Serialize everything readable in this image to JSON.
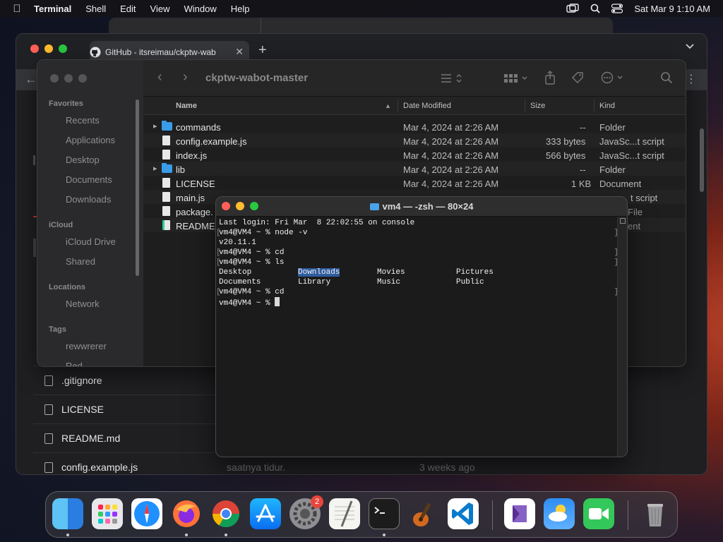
{
  "menubar": {
    "app_name": "Terminal",
    "items": [
      "Shell",
      "Edit",
      "View",
      "Window",
      "Help"
    ],
    "clock": "Sat Mar 9  1:10 AM"
  },
  "browser": {
    "tab_title": "GitHub - itsreimau/ckptw-wab",
    "tab_close": "✕",
    "new_tab": "+",
    "files": [
      ".gitignore",
      "LICENSE",
      "README.md",
      "config.example.js"
    ],
    "commit_message": "saatnya tidur.",
    "commit_time": "3 weeks ago"
  },
  "finder": {
    "title": "ckptw-wabot-master",
    "sidebar": {
      "favorites_label": "Favorites",
      "favorites": [
        "Recents",
        "Applications",
        "Desktop",
        "Documents",
        "Downloads"
      ],
      "icloud_label": "iCloud",
      "icloud": [
        "iCloud Drive",
        "Shared"
      ],
      "locations_label": "Locations",
      "locations": [
        "Network"
      ],
      "tags_label": "Tags",
      "tags": [
        "rewwrerer",
        "Red"
      ]
    },
    "columns": {
      "name": "Name",
      "date": "Date Modified",
      "size": "Size",
      "kind": "Kind"
    },
    "rows": [
      {
        "name": "commands",
        "date": "Mar 4, 2024 at 2:26 AM",
        "size": "--",
        "kind": "Folder"
      },
      {
        "name": "config.example.js",
        "date": "Mar 4, 2024 at 2:26 AM",
        "size": "333 bytes",
        "kind": "JavaSc...t script"
      },
      {
        "name": "index.js",
        "date": "Mar 4, 2024 at 2:26 AM",
        "size": "566 bytes",
        "kind": "JavaSc...t script"
      },
      {
        "name": "lib",
        "date": "Mar 4, 2024 at 2:26 AM",
        "size": "--",
        "kind": "Folder"
      },
      {
        "name": "LICENSE",
        "date": "Mar 4, 2024 at 2:26 AM",
        "size": "1 KB",
        "kind": "Document"
      },
      {
        "name": "main.js",
        "date": "",
        "size": "",
        "kind": "t script"
      },
      {
        "name": "package.",
        "date": "",
        "size": "",
        "kind": "File"
      },
      {
        "name": "README.",
        "date": "",
        "size": "",
        "kind": "ent"
      }
    ]
  },
  "terminal": {
    "title": "vm4 — -zsh — 80×24",
    "lines": {
      "login": "Last login: Fri Mar  8 22:02:55 on console",
      "cmd1": "vm4@VM4 ~ % node -v",
      "out1": "v20.11.1",
      "cmd2": "vm4@VM4 ~ % cd",
      "cmd3": "vm4@VM4 ~ % ls",
      "cmd4": "vm4@VM4 ~ % cd",
      "prompt": "vm4@VM4 ~ % "
    },
    "ls_row1": [
      "Desktop",
      "Downloads",
      "Movies",
      "Pictures"
    ],
    "ls_row2": [
      "Documents",
      "Library",
      "Music",
      "Public"
    ]
  },
  "dock": {
    "badge_count": "2",
    "apps": [
      "Finder",
      "Launchpad",
      "Safari",
      "Firefox",
      "Chrome",
      "App Store",
      "System Settings",
      "TextEdit",
      "Terminal",
      "GarageBand",
      "Visual Studio Code",
      "Visual Studio",
      "Weather",
      "FaceTime",
      "Trash"
    ]
  }
}
